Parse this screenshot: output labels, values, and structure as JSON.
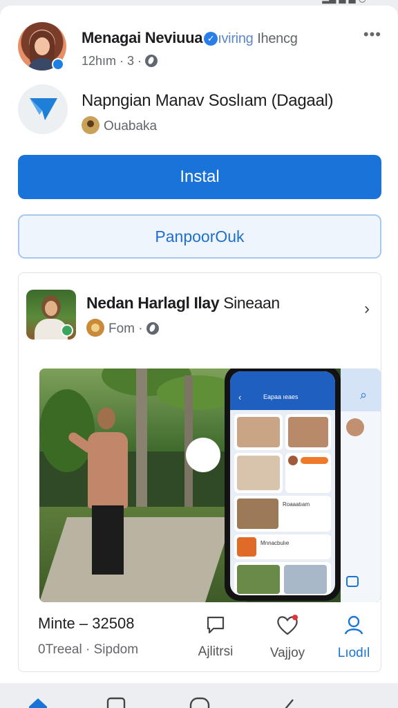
{
  "post": {
    "author": "Menagai Neviuua",
    "sub_blue": "ıviring",
    "sub_grey": "Ihencg",
    "meta": "12hım · 3 ·"
  },
  "app": {
    "name": "Napngian Manav Soslıam (Dagaal)",
    "developer": "Ouabaka"
  },
  "buttons": {
    "install": "Instal",
    "secondary": "PanpoorOuk"
  },
  "card": {
    "title_bold": "Nedan Harlagl Ilay",
    "title_thin": "Sineaan",
    "meta": "Fom ·",
    "phone_header": "Eapaa ıeaes",
    "phone_row1": "Roaaatıam",
    "phone_row2": "Mnnacbulıe",
    "stat_primary": "Minte  – 32508",
    "stat_secondary": "0Treeal · Sipdom"
  },
  "actions": [
    {
      "label": "Ajlitrsi",
      "icon": "comment-icon"
    },
    {
      "label": "Vajjoy",
      "icon": "heart-icon"
    },
    {
      "label": "Lıodıl",
      "icon": "profile-icon"
    }
  ],
  "colors": {
    "accent": "#1a73d8",
    "secondary_bg": "#eef5fd",
    "secondary_border": "#a6c8ef"
  }
}
